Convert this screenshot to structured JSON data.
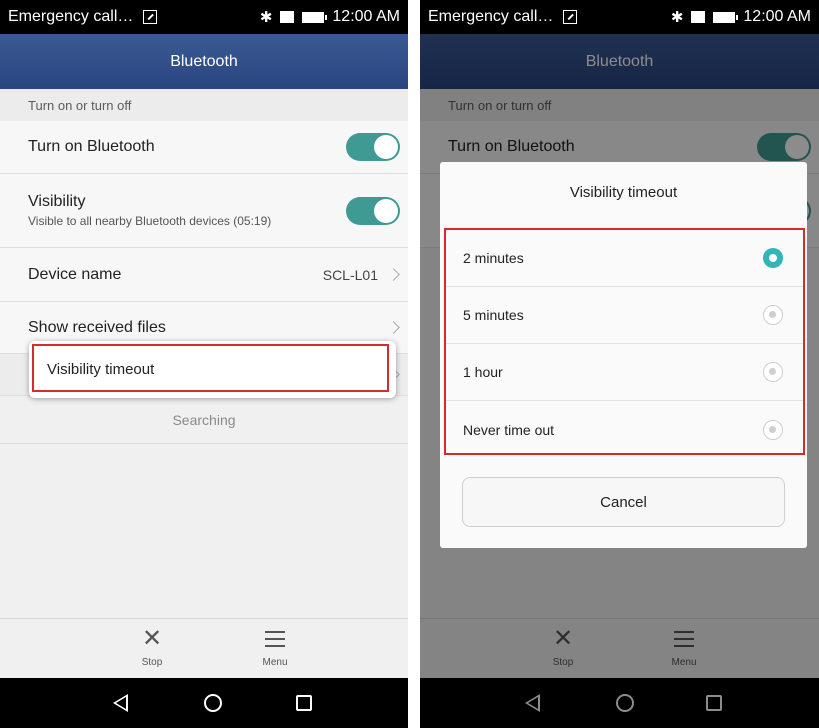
{
  "status_bar": {
    "left_text": "Emergency call…",
    "time": "12:00 AM",
    "icons": [
      "edit-icon",
      "bluetooth-icon",
      "sim-card-icon",
      "battery-icon"
    ]
  },
  "app_bar": {
    "title": "Bluetooth"
  },
  "settings": {
    "section_header": "Turn on or turn off",
    "turn_on": {
      "label": "Turn on Bluetooth",
      "enabled": true
    },
    "visibility": {
      "label": "Visibility",
      "sublabel": "Visible to all nearby Bluetooth devices (05:19)",
      "enabled": true
    },
    "device_name": {
      "label": "Device name",
      "value": "SCL-L01"
    },
    "received_files": {
      "label": "Show received files"
    },
    "searching": "Searching"
  },
  "popup_menu": {
    "item": "Visibility timeout"
  },
  "bottom_bar": {
    "stop_label": "Stop",
    "menu_label": "Menu"
  },
  "dialog": {
    "title": "Visibility timeout",
    "options": [
      {
        "label": "2 minutes",
        "selected": true
      },
      {
        "label": "5 minutes",
        "selected": false
      },
      {
        "label": "1 hour",
        "selected": false
      },
      {
        "label": "Never time out",
        "selected": false
      }
    ],
    "cancel_label": "Cancel"
  },
  "colors": {
    "accent": "#3f9a93",
    "app_bar": "#304d88",
    "highlight": "#d52b2b"
  }
}
